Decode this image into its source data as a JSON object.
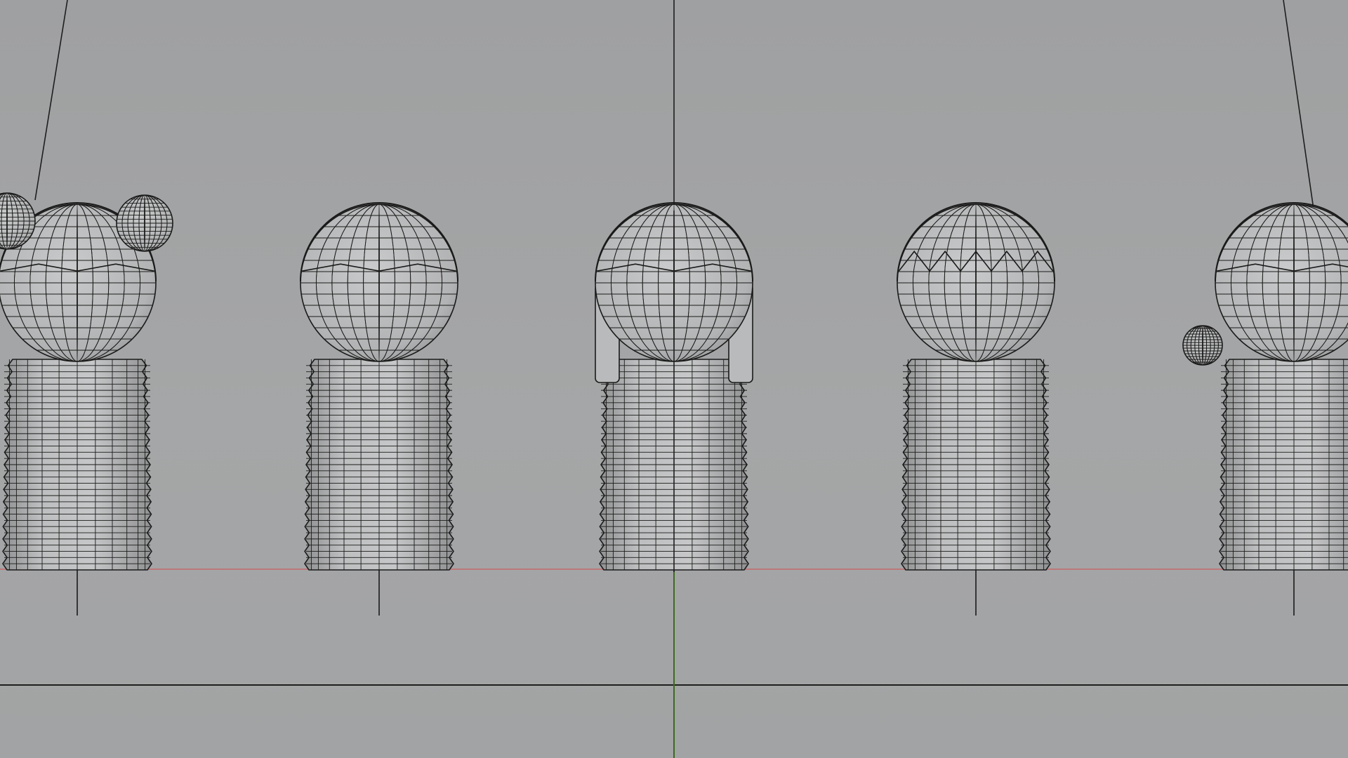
{
  "viewport": {
    "view": "front",
    "background_color": "#a3a4a5",
    "wireframe_color": "#1a1a1a",
    "surface_color": "#bcbdbe",
    "shadow_color": "#8e8f90",
    "ground_axis_color": "#c46a6a",
    "vertical_axis_color": "#3a6a1a",
    "figures": [
      {
        "name": "figure-bun-hair",
        "accessory": "buns"
      },
      {
        "name": "figure-plain",
        "accessory": "none"
      },
      {
        "name": "figure-long-sides",
        "accessory": "side-locks"
      },
      {
        "name": "figure-spiky-fringe",
        "accessory": "spiky-fringe"
      },
      {
        "name": "figure-side-bun",
        "accessory": "side-bun"
      }
    ]
  }
}
